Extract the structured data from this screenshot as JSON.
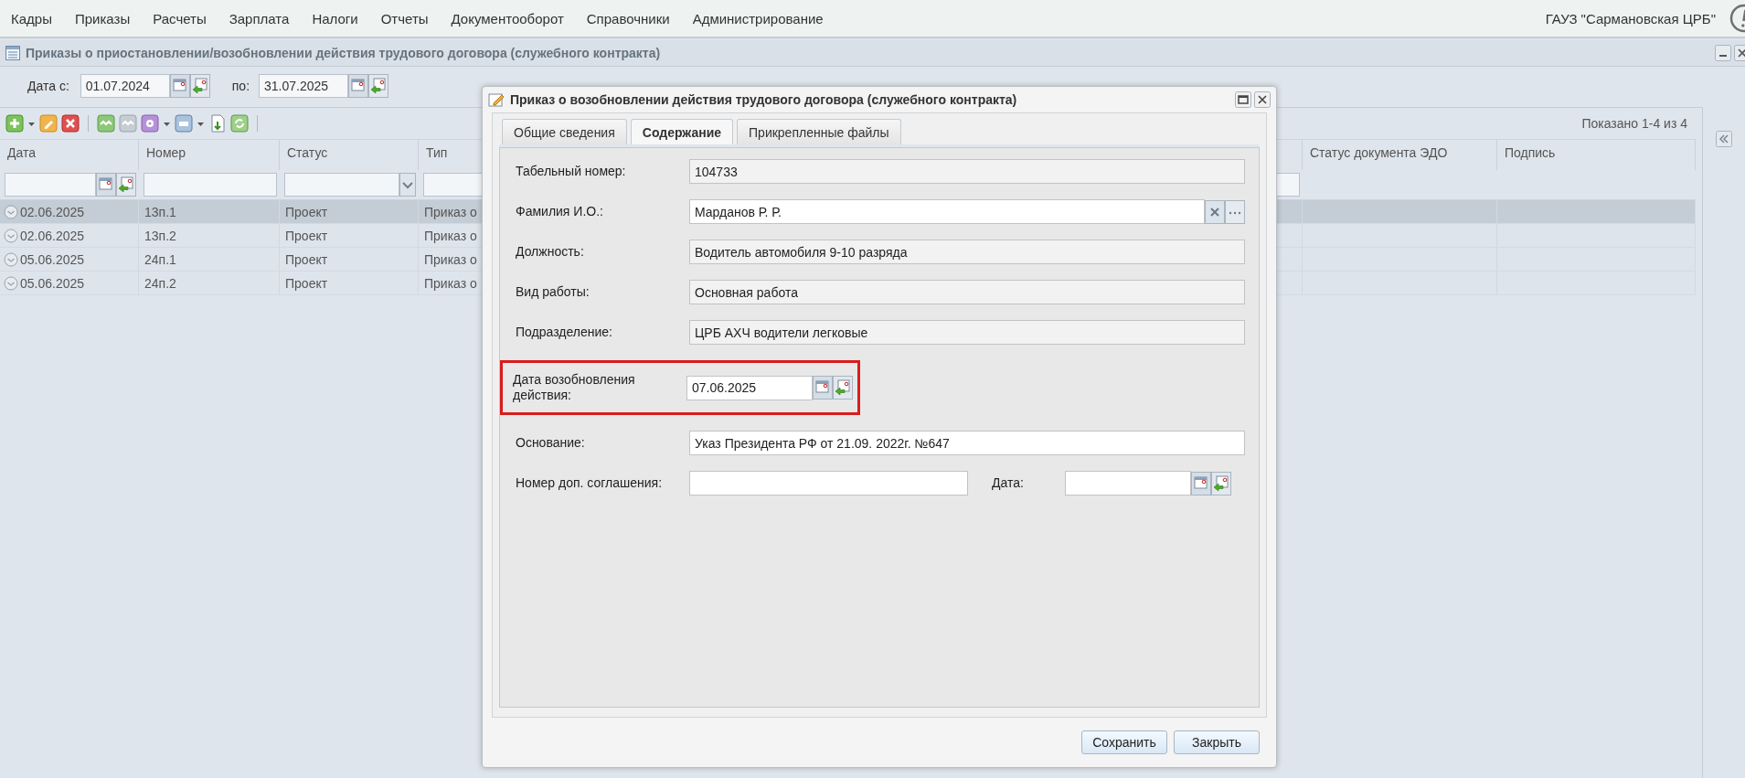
{
  "menu": {
    "items": [
      "Кадры",
      "Приказы",
      "Расчеты",
      "Зарплата",
      "Налоги",
      "Отчеты",
      "Документооборот",
      "Справочники",
      "Администрирование"
    ],
    "organization": "ГАУЗ \"Сармановская ЦРБ\""
  },
  "panel": {
    "title": "Приказы о приостановлении/возобновлении действия трудового договора (служебного контракта)",
    "filter": {
      "from_label": "Дата с:",
      "from_value": "01.07.2024",
      "to_label": "по:",
      "to_value": "31.07.2025"
    },
    "toolbar": {
      "paging": "Показано 1-4 из 4"
    },
    "grid": {
      "columns": [
        {
          "title": "Дата",
          "kind": "date"
        },
        {
          "title": "Номер",
          "kind": "text"
        },
        {
          "title": "Статус",
          "kind": "combo"
        },
        {
          "title": "Тип",
          "kind": "text"
        },
        {
          "title": "Статус документа ЭДО",
          "kind": "none"
        },
        {
          "title": "Подпись",
          "kind": "none"
        }
      ],
      "rows": [
        {
          "cells": [
            "02.06.2025",
            "13п.1",
            "Проект",
            "Приказ о"
          ],
          "selected": true
        },
        {
          "cells": [
            "02.06.2025",
            "13п.2",
            "Проект",
            "Приказ о"
          ],
          "selected": false
        },
        {
          "cells": [
            "05.06.2025",
            "24п.1",
            "Проект",
            "Приказ о"
          ],
          "selected": false
        },
        {
          "cells": [
            "05.06.2025",
            "24п.2",
            "Проект",
            "Приказ о"
          ],
          "selected": false
        }
      ]
    }
  },
  "dialog": {
    "title": "Приказ о возобновлении действия трудового договора (служебного контракта)",
    "tabs": [
      {
        "label": "Общие сведения",
        "selected": false
      },
      {
        "label": "Содержание",
        "selected": true
      },
      {
        "label": "Прикрепленные файлы",
        "selected": false
      }
    ],
    "form_rows": [
      {
        "highlighted": false,
        "fields": [
          {
            "label": "Табельный номер:",
            "value": "104733",
            "kind": "text",
            "readonly": true
          }
        ]
      },
      {
        "highlighted": false,
        "fields": [
          {
            "label": "Фамилия И.О.:",
            "value": "Марданов Р. Р.",
            "kind": "lookup",
            "readonly": false
          }
        ]
      },
      {
        "highlighted": false,
        "fields": [
          {
            "label": "Должность:",
            "value": "Водитель автомобиля 9-10 разряда",
            "kind": "text",
            "readonly": true
          }
        ]
      },
      {
        "highlighted": false,
        "fields": [
          {
            "label": "Вид работы:",
            "value": "Основная работа",
            "kind": "text",
            "readonly": true
          }
        ]
      },
      {
        "highlighted": false,
        "fields": [
          {
            "label": "Подразделение:",
            "value": "ЦРБ АХЧ водители легковые",
            "kind": "text",
            "readonly": true
          }
        ]
      },
      {
        "highlighted": true,
        "fields": [
          {
            "label": "Дата возобновления действия:",
            "value": "07.06.2025",
            "kind": "date",
            "readonly": false
          }
        ]
      },
      {
        "highlighted": false,
        "fields": [
          {
            "label": "Основание:",
            "value": "Указ Президента РФ от 21.09. 2022г. №647",
            "kind": "text",
            "readonly": false
          }
        ]
      },
      {
        "highlighted": false,
        "fields": [
          {
            "label": "Номер доп. соглашения:",
            "kind": "text",
            "readonly": false
          },
          {
            "label": "Дата:",
            "kind": "date",
            "readonly": false
          }
        ]
      }
    ],
    "buttons": [
      "Сохранить",
      "Закрыть"
    ]
  }
}
